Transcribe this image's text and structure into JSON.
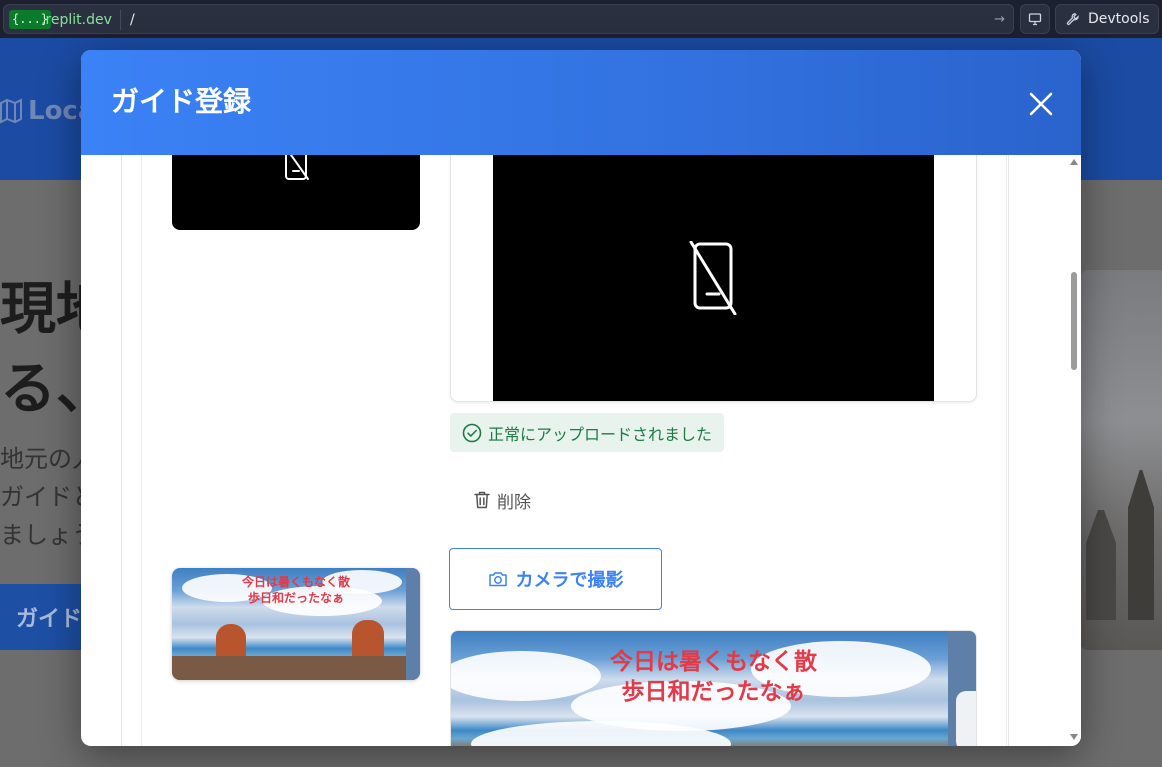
{
  "browser": {
    "url_prefix": "{...}",
    "url_domain": ".replit.dev",
    "url_path": "/",
    "devtools_label": "Devtools"
  },
  "background": {
    "logo_text": "Loca",
    "hero_line1": "現地",
    "hero_line2": "る、",
    "desc_line1": "地元の人",
    "desc_line2": "ガイドと",
    "desc_line3": "ましょう",
    "cta_label": "ガイド"
  },
  "modal": {
    "title": "ガイド登録",
    "upload_status": "正常にアップロードされました",
    "delete_label": "削除",
    "camera_label": "カメラで撮影",
    "photo_caption": "今日は暑くもなく散\n歩日和だったなぁ"
  },
  "colors": {
    "modal_header": "#3b82f6",
    "success_bg": "#e7f3ec",
    "success_text": "#1f7a45",
    "accent": "#3b82f6"
  }
}
